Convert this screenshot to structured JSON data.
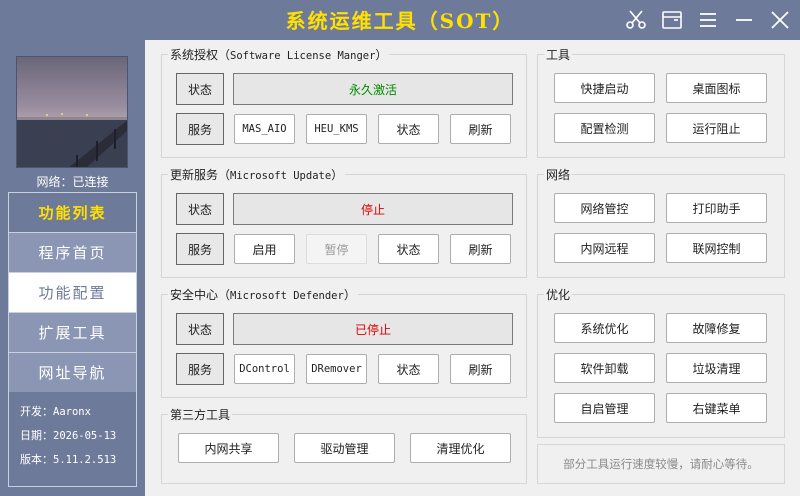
{
  "app": {
    "title": "系统运维工具（SOT）"
  },
  "sidebar": {
    "network_status": "网络：已连接",
    "menu_header": "功能列表",
    "menu_items": [
      "程序首页",
      "功能配置",
      "扩展工具",
      "网址导航"
    ],
    "active_item": "功能配置",
    "developer_label": "开发：",
    "developer_value": "Aaronx",
    "date_label": "日期：",
    "date_value": "2026-05-13",
    "version_label": "版本：",
    "version_value": "5.11.2.513"
  },
  "license": {
    "title_cn": "系统授权（",
    "title_en": "Software License Manger",
    "title_end": "）",
    "status_label": "状态",
    "status_value": "永久激活",
    "service_label": "服务",
    "buttons": [
      "MAS_AIO",
      "HEU_KMS",
      "状态",
      "刷新"
    ]
  },
  "update": {
    "title_cn": "更新服务（",
    "title_en": "Microsoft Update",
    "title_end": "）",
    "status_label": "状态",
    "status_value": "停止",
    "service_label": "服务",
    "buttons": [
      "启用",
      "暂停",
      "状态",
      "刷新"
    ]
  },
  "defender": {
    "title_cn": "安全中心（",
    "title_en": "Microsoft Defender",
    "title_end": "）",
    "status_label": "状态",
    "status_value": "已停止",
    "service_label": "服务",
    "buttons": [
      "DControl",
      "DRemover",
      "状态",
      "刷新"
    ]
  },
  "third_party": {
    "title": "第三方工具",
    "buttons": [
      "内网共享",
      "驱动管理",
      "清理优化"
    ]
  },
  "tools": {
    "title": "工具",
    "buttons": [
      "快捷启动",
      "桌面图标",
      "配置检测",
      "运行阻止"
    ]
  },
  "network": {
    "title": "网络",
    "buttons": [
      "网络管控",
      "打印助手",
      "内网远程",
      "联网控制"
    ]
  },
  "optimize": {
    "title": "优化",
    "buttons": [
      "系统优化",
      "故障修复",
      "软件卸载",
      "垃圾清理",
      "自启管理",
      "右键菜单"
    ]
  },
  "notice": "部分工具运行速度较慢，请耐心等待。",
  "colors": {
    "frame": "#6e7a99",
    "title_yellow": "#ffe000",
    "status_green": "#008a00",
    "status_red": "#e00000"
  }
}
